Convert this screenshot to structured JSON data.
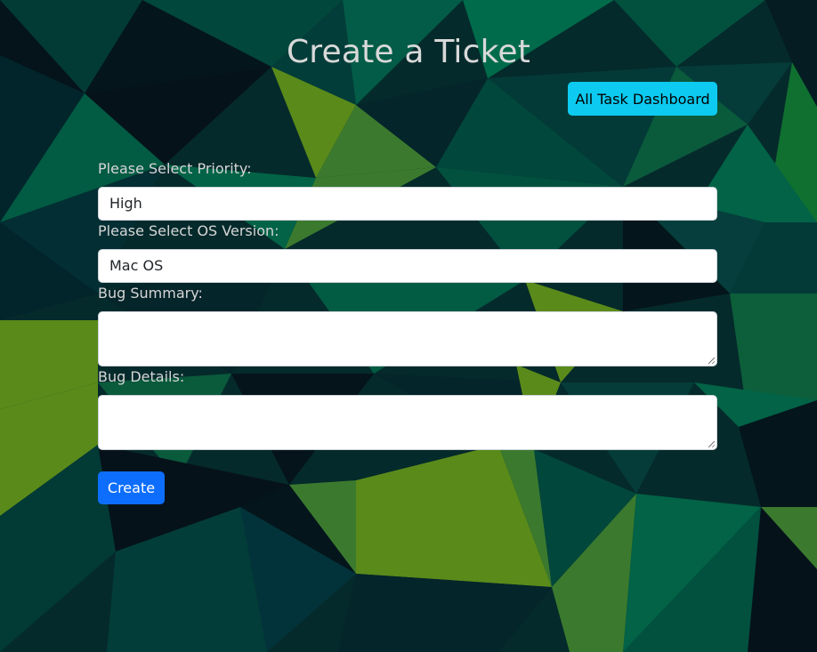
{
  "page": {
    "title": "Create a Ticket",
    "dashboard_button_label": "All Task Dashboard"
  },
  "form": {
    "priority": {
      "label": "Please Select Priority:",
      "value": "High"
    },
    "os_version": {
      "label": "Please Select OS Version:",
      "value": "Mac OS"
    },
    "bug_summary": {
      "label": "Bug Summary:",
      "value": ""
    },
    "bug_details": {
      "label": "Bug Details:",
      "value": ""
    },
    "submit_label": "Create"
  },
  "colors": {
    "dashboard_button": "#0dcaf0",
    "create_button": "#0d6efd",
    "background_dark": "#062c2c",
    "background_green": "#00664a",
    "background_lime": "#5a8a1a"
  }
}
